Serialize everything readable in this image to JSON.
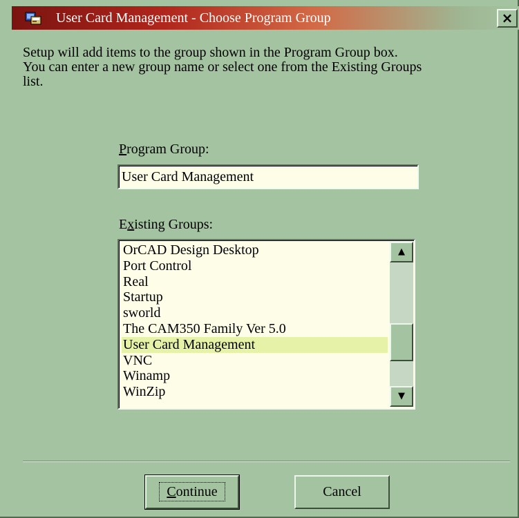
{
  "window": {
    "title": "User Card Management - Choose Program Group",
    "close_label": "×"
  },
  "intro": {
    "text": "Setup will add items to the group shown in the Program Group box.\nYou can enter a new group name or select one from the Existing Groups\nlist."
  },
  "program_group": {
    "label_accel": "P",
    "label_rest": "rogram Group:",
    "value": "User Card Management"
  },
  "existing_groups": {
    "label_pre": "E",
    "label_accel": "x",
    "label_rest": "isting Groups:",
    "items": [
      "OrCAD Design Desktop",
      "Port Control",
      "Real",
      "Startup",
      "sworld",
      "The CAM350 Family Ver 5.0",
      "User Card Management",
      "VNC",
      "Winamp",
      "WinZip"
    ],
    "selected_index": 6
  },
  "scrollbar": {
    "up_glyph": "▲",
    "down_glyph": "▼"
  },
  "buttons": {
    "continue_accel": "C",
    "continue_rest": "ontinue",
    "cancel": "Cancel"
  },
  "colors": {
    "dialog_bg": "#a4c3a1",
    "titlebar_start": "#7a1410",
    "selection_bg": "#e6f2a8",
    "field_bg": "#fdfde8"
  }
}
